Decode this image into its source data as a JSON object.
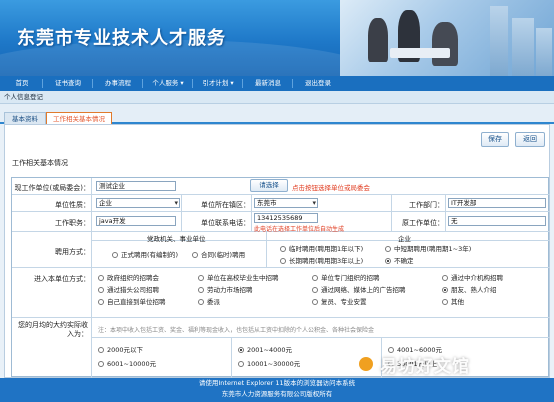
{
  "banner": {
    "title": "东莞市专业技术人才服务"
  },
  "nav": {
    "items": [
      "首页",
      "证书查询",
      "办事流程",
      "个人服务 ▾",
      "引才计划 ▾",
      "最新消息",
      "退出登录"
    ]
  },
  "breadcrumb": "个人信息登记",
  "tabs": {
    "basic": "基本资料",
    "work": "工作相关基本情况"
  },
  "buttons": {
    "save": "保存",
    "back": "返回",
    "choose": "请选择"
  },
  "form": {
    "section_title": "工作相关基本情况",
    "unit_label": "现工作单位(或局委会)：",
    "unit_value": "测试企业",
    "unit_hint": "点击按钮选择单位或局委会",
    "nature_label": "单位性质：",
    "nature_value": "企业",
    "district_label": "单位所在镇区：",
    "district_value": "东莞市",
    "dept_label": "工作部门：",
    "dept_value": "IT开发部",
    "post_label": "工作职务：",
    "post_value": "java开发",
    "phone_label": "单位联系电话：",
    "phone_value": "13412535689",
    "phone_hint": "此电话在选择工作单位后自动生成",
    "orig_unit_label": "原工作单位：",
    "orig_unit_value": "无",
    "hire_label": "聘用方式：",
    "hire_group1": "党政机关、事业单位",
    "hire_group2": "企业",
    "hire_opts": [
      "正式聘用(有编制的)",
      "合同(临时)聘用",
      "临时聘用(聘用期1年以下)",
      "中短期聘用(聘用期1~3年)",
      "长期聘用(聘用期3年以上)",
      "不确定"
    ],
    "entry_label": "进入本单位方式：",
    "entry_opts": [
      "政府组织的招聘会",
      "单位在高校毕业生中招聘",
      "单位专门组织的招聘",
      "通过中介机构招聘",
      "通过猎头公司招聘",
      "劳动力市场招聘",
      "通过网络、媒体上的广告招聘",
      "朋友、熟人介绍",
      "自己直接到单位招聘",
      "委派",
      "复员、专业安置",
      "其他"
    ],
    "income_label": "您的月均的大约实际收入为：",
    "income_note": "注：本项中收入包括工资、奖金、福利等现金收入，也包括从工资中扣除的个人公积金、各种社会保险金",
    "income_opts": [
      "2000元以下",
      "2001~4000元",
      "4001~6000元",
      "6001~10000元",
      "10001~30000元",
      "30001元以上"
    ]
  },
  "footer": {
    "line1": "请使用Internet Explorer 11版本的浏览器访问本系统",
    "line2": "东莞市人力资源服务有限公司版权所有"
  },
  "watermark": "易坊好文馆"
}
